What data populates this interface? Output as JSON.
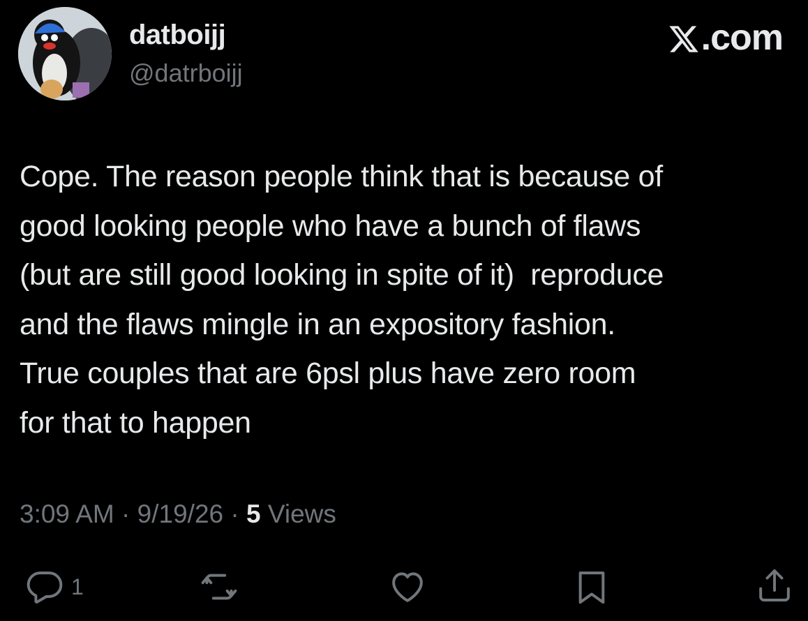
{
  "author": {
    "display_name": "datboijj",
    "handle": "@datrboijj"
  },
  "brand": {
    "label": ".com",
    "icon": "x-logo-icon"
  },
  "tweet": {
    "text": "Cope. The reason people think that is because of\ngood looking people who have a bunch of flaws\n(but are still good looking in spite of it)  reproduce\nand the flaws mingle in an expository fashion.\nTrue couples that are 6psl plus have zero room\nfor that to happen"
  },
  "meta": {
    "time": "3:09 AM",
    "separator": " · ",
    "date": "9/19/26",
    "views_count": "5",
    "views_label": " Views"
  },
  "actions": {
    "reply": {
      "icon": "reply-icon",
      "count": "1"
    },
    "repost": {
      "icon": "repost-icon"
    },
    "like": {
      "icon": "heart-icon"
    },
    "bookmark": {
      "icon": "bookmark-icon"
    },
    "share": {
      "icon": "share-icon"
    }
  },
  "colors": {
    "background": "#000000",
    "primary_text": "#e7e9ea",
    "secondary_text": "#71767b"
  }
}
